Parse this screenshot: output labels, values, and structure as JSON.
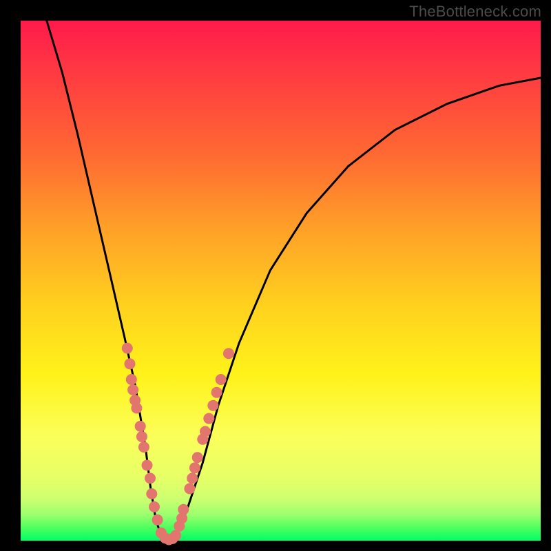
{
  "watermark": "TheBottleneck.com",
  "colors": {
    "dot": "#e2756e",
    "curve": "#000000",
    "frame": "#000000"
  },
  "chart_data": {
    "type": "line",
    "title": "",
    "xlabel": "",
    "ylabel": "",
    "xlim": [
      0,
      100
    ],
    "ylim": [
      0,
      100
    ],
    "grid": false,
    "legend": false,
    "series": [
      {
        "name": "bottleneck-curve",
        "x": [
          5,
          8,
          11,
          14,
          17,
          20,
          22,
          24,
          25,
          26,
          27,
          28,
          29,
          30,
          32,
          35,
          38,
          42,
          48,
          55,
          63,
          72,
          82,
          92,
          100
        ],
        "y": [
          100,
          90,
          78,
          65,
          52,
          39,
          30,
          18,
          10,
          4,
          1,
          0,
          0,
          1,
          6,
          15,
          26,
          38,
          52,
          63,
          72,
          79,
          84,
          87.5,
          89
        ]
      }
    ],
    "scatter_points": [
      {
        "x": 20.5,
        "y": 37
      },
      {
        "x": 21.0,
        "y": 34
      },
      {
        "x": 21.3,
        "y": 31
      },
      {
        "x": 21.6,
        "y": 29
      },
      {
        "x": 22.0,
        "y": 27
      },
      {
        "x": 22.3,
        "y": 25.5
      },
      {
        "x": 23.0,
        "y": 22
      },
      {
        "x": 23.3,
        "y": 20
      },
      {
        "x": 23.7,
        "y": 18
      },
      {
        "x": 24.3,
        "y": 14.5
      },
      {
        "x": 24.9,
        "y": 12
      },
      {
        "x": 25.2,
        "y": 9
      },
      {
        "x": 25.7,
        "y": 6.5
      },
      {
        "x": 26.3,
        "y": 4
      },
      {
        "x": 27.0,
        "y": 1.5
      },
      {
        "x": 27.8,
        "y": 0.5
      },
      {
        "x": 28.5,
        "y": 0.2
      },
      {
        "x": 29.2,
        "y": 0.4
      },
      {
        "x": 29.8,
        "y": 1.0
      },
      {
        "x": 30.5,
        "y": 2.8
      },
      {
        "x": 31.0,
        "y": 4.3
      },
      {
        "x": 31.3,
        "y": 6
      },
      {
        "x": 32.5,
        "y": 10
      },
      {
        "x": 33.0,
        "y": 12
      },
      {
        "x": 33.5,
        "y": 14
      },
      {
        "x": 34.0,
        "y": 16
      },
      {
        "x": 35.0,
        "y": 19.5
      },
      {
        "x": 35.5,
        "y": 21
      },
      {
        "x": 36.2,
        "y": 23.5
      },
      {
        "x": 37.0,
        "y": 26
      },
      {
        "x": 37.7,
        "y": 28.5
      },
      {
        "x": 38.5,
        "y": 31
      },
      {
        "x": 40.0,
        "y": 36
      }
    ]
  }
}
